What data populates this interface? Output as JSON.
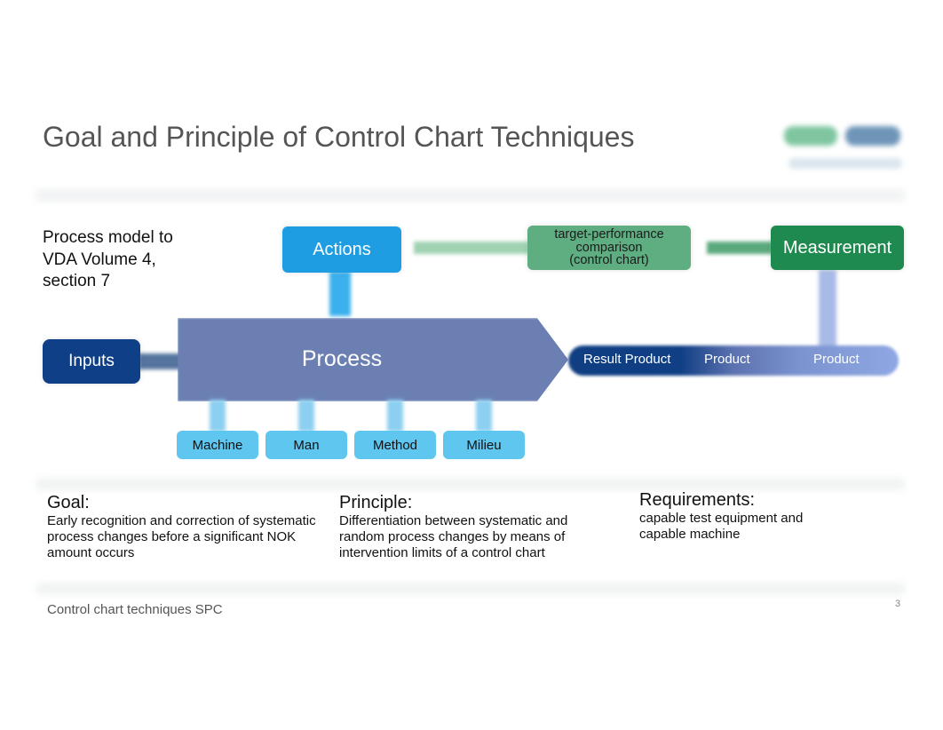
{
  "slide": {
    "title": "Goal and Principle of Control Chart Techniques",
    "intro_lines": [
      "Process model to",
      "VDA Volume 4,",
      "section 7"
    ],
    "footer": "Control chart techniques SPC",
    "page_number": "3"
  },
  "diagram": {
    "actions": "Actions",
    "comparison_lines": [
      "target-performance",
      "comparison",
      "(control chart)"
    ],
    "measurement": "Measurement",
    "inputs": "Inputs",
    "process": "Process",
    "outputs": [
      "Result Product",
      "Product",
      "Product"
    ],
    "factors": [
      "Machine",
      "Man",
      "Method",
      "Milieu"
    ],
    "colors": {
      "actions": "#1f9de3",
      "comparison": "#5fae82",
      "measurement": "#1f8a4f",
      "inputs": "#0f3f86",
      "process": "#6b7fb3",
      "factors": "#5ec6ef"
    }
  },
  "sections": [
    {
      "heading": "Goal:",
      "lines": [
        "Early recognition and correction of systematic",
        "process changes before a significant NOK",
        "amount occurs"
      ]
    },
    {
      "heading": "Principle:",
      "lines": [
        "Differentiation between systematic and",
        "random process changes by means of",
        "intervention limits of a control chart"
      ]
    },
    {
      "heading": "Requirements:",
      "lines": [
        "capable test equipment and",
        "capable machine"
      ]
    }
  ]
}
